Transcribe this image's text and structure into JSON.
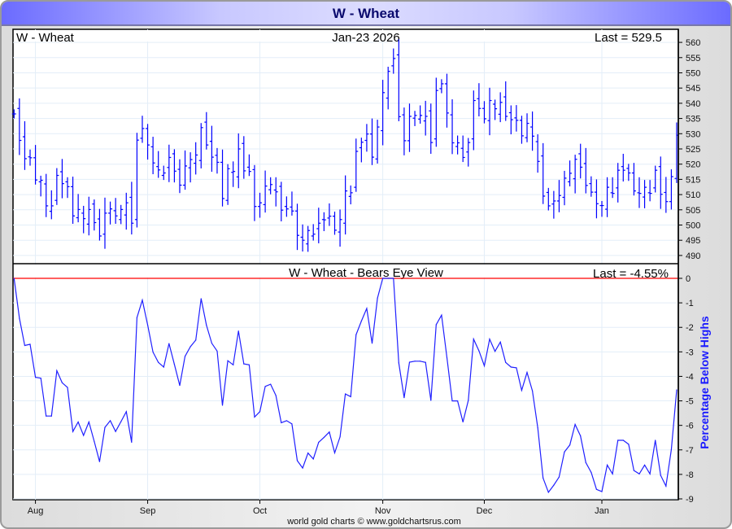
{
  "window_title": "W  -  Wheat",
  "footer": "world gold charts © www.goldchartsrus.com",
  "colors": {
    "bars": "#0000ff",
    "line": "#2020ff",
    "zero_line": "#ff0000",
    "grid": "#e3eef8",
    "axis_label": "#1a1aff"
  },
  "chart_data": [
    {
      "type": "ohlc",
      "title": "W  -  Wheat",
      "date": "Jan-23  2026",
      "last_label": "Last = 529.5",
      "ylim": [
        487.3,
        564.3
      ],
      "yticks": [
        490,
        495,
        500,
        505,
        510,
        515,
        520,
        525,
        530,
        535,
        540,
        545,
        550,
        555,
        560
      ],
      "x_ticks": [
        "Aug",
        "Sep",
        "Oct",
        "Nov",
        "Dec",
        "Jan"
      ],
      "x_tick_bar_index": [
        4,
        25,
        46,
        69,
        88,
        110
      ],
      "close": [
        536.5,
        527.8,
        521.8,
        522.1,
        514.8,
        514.7,
        506.3,
        506.3,
        516.3,
        513.6,
        512.6,
        503.0,
        505.1,
        502.1,
        505.1,
        500.8,
        496.4,
        503.9,
        505.3,
        503.0,
        505.1,
        507.3,
        500.6,
        527.9,
        531.7,
        526.3,
        520.4,
        518.1,
        517.1,
        522.2,
        517.7,
        513.1,
        519.4,
        521.5,
        523.0,
        532.0,
        526.3,
        522.3,
        520.6,
        508.7,
        518.5,
        517.6,
        525.0,
        517.8,
        517.6,
        506.1,
        507.3,
        512.8,
        513.3,
        510.9,
        504.9,
        505.3,
        504.6,
        496.6,
        495.0,
        498.2,
        497.0,
        500.6,
        501.7,
        502.9,
        498.3,
        501.8,
        511.2,
        510.6,
        524.2,
        527.2,
        529.9,
        522.3,
        532.2,
        543.5,
        550.5,
        554.7,
        535.6,
        527.7,
        535.7,
        536.0,
        536.0,
        535.7,
        527.1,
        544.2,
        546.4,
        536.8,
        527.0,
        527.0,
        522.2,
        527.1,
        540.9,
        538.3,
        534.9,
        540.9,
        538.2,
        540.3,
        535.7,
        534.6,
        534.4,
        529.3,
        533.4,
        529.2,
        520.9,
        509.5,
        506.3,
        507.9,
        509.7,
        515.4,
        517.0,
        521.6,
        519.0,
        513.0,
        510.8,
        507.0,
        506.4,
        512.4,
        510.4,
        518.0,
        518.0,
        517.1,
        511.2,
        510.4,
        512.4,
        510.4,
        518.0,
        510.1,
        507.7,
        515.9,
        529.5
      ]
    },
    {
      "type": "line",
      "title": "W  -  Wheat - Bears Eye View",
      "last_label": "Last = -4.55%",
      "ylabel": "Percentage Below Highs",
      "ylim": [
        -9,
        0
      ],
      "yticks": [
        0,
        -1,
        -2,
        -3,
        -4,
        -5,
        -6,
        -7,
        -8,
        -9
      ],
      "values": [
        0,
        -1.63,
        -2.74,
        -2.69,
        -4.04,
        -4.07,
        -5.62,
        -5.62,
        -3.77,
        -4.26,
        -4.45,
        -6.25,
        -5.86,
        -6.41,
        -5.86,
        -6.66,
        -7.48,
        -6.08,
        -5.81,
        -6.25,
        -5.85,
        -5.44,
        -6.69,
        -1.6,
        -0.89,
        -1.91,
        -3.01,
        -3.43,
        -3.62,
        -2.66,
        -3.51,
        -4.37,
        -3.18,
        -2.79,
        -2.52,
        -0.83,
        -1.91,
        -2.65,
        -2.97,
        -5.18,
        -3.36,
        -3.53,
        -2.15,
        -3.49,
        -3.53,
        -5.66,
        -5.44,
        -4.41,
        -4.32,
        -4.78,
        -5.89,
        -5.81,
        -5.94,
        -7.44,
        -7.74,
        -7.13,
        -7.37,
        -6.69,
        -6.49,
        -6.27,
        -7.12,
        -6.47,
        -4.72,
        -4.83,
        -2.3,
        -1.74,
        -1.23,
        -2.65,
        -0.81,
        0,
        0,
        0,
        -3.45,
        -4.87,
        -3.42,
        -3.38,
        -3.38,
        -3.43,
        -4.98,
        -1.89,
        -1.5,
        -3.23,
        -5.0,
        -5.0,
        -5.86,
        -4.98,
        -2.48,
        -2.96,
        -3.57,
        -2.48,
        -2.98,
        -2.6,
        -3.43,
        -3.62,
        -3.65,
        -4.57,
        -3.84,
        -4.59,
        -6.1,
        -8.15,
        -8.73,
        -8.44,
        -8.11,
        -7.08,
        -6.8,
        -5.96,
        -6.43,
        -7.52,
        -7.92,
        -8.61,
        -8.7,
        -7.62,
        -7.98,
        -6.61,
        -6.61,
        -6.77,
        -7.84,
        -7.98,
        -7.62,
        -7.98,
        -6.61,
        -8.04,
        -8.48,
        -6.99,
        -4.55
      ]
    }
  ]
}
